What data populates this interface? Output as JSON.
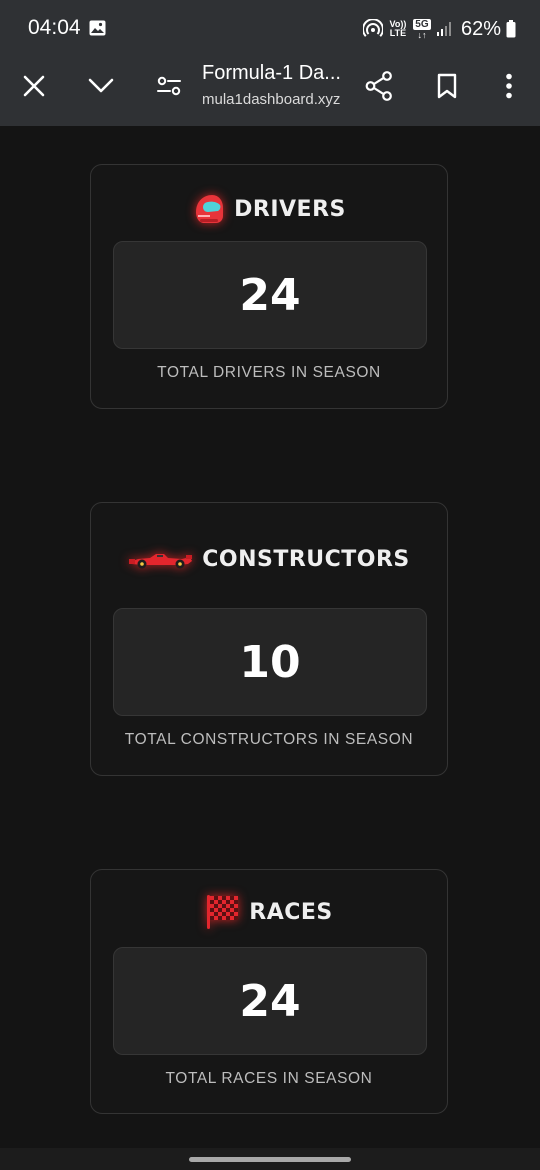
{
  "status_bar": {
    "time": "04:04",
    "volte_label": "Vo)) LTE",
    "network_label": "5G",
    "battery": "62%",
    "icons": [
      "gallery-icon",
      "hotspot-icon",
      "volte-icon",
      "5g-icon",
      "signal-icon",
      "battery-icon"
    ]
  },
  "toolbar": {
    "title": "Formula-1 Da...",
    "url": "mula1dashboard.xyz",
    "icons": [
      "close-icon",
      "chevron-down-icon",
      "site-settings-icon",
      "share-icon",
      "bookmark-icon",
      "more-vert-icon"
    ]
  },
  "cards": [
    {
      "title": "DRIVERS",
      "icon": "helmet-icon",
      "value": "24",
      "caption": "TOTAL DRIVERS IN SEASON"
    },
    {
      "title": "CONSTRUCTORS",
      "icon": "race-car-icon",
      "value": "10",
      "caption": "TOTAL CONSTRUCTORS IN SEASON"
    },
    {
      "title": "RACES",
      "icon": "checkered-flag-icon",
      "value": "24",
      "caption": "TOTAL RACES IN SEASON"
    }
  ],
  "colors": {
    "background": "#141414",
    "toolbar": "#2f3134",
    "card_border": "#343434",
    "value_box": "#252525",
    "accent_red": "#e8252b"
  }
}
